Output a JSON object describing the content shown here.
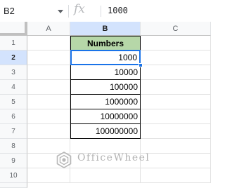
{
  "formula_bar": {
    "name_box": "B2",
    "fx_symbol": "fx",
    "formula_value": "1000"
  },
  "columns": [
    {
      "label": "A"
    },
    {
      "label": "B"
    },
    {
      "label": "C"
    }
  ],
  "rows": [
    "1",
    "2",
    "3",
    "4",
    "5",
    "6",
    "7",
    "8",
    "9",
    "10"
  ],
  "sheet": {
    "b_header": "Numbers",
    "b_values": [
      "1000",
      "10000",
      "100000",
      "1000000",
      "10000000",
      "100000000"
    ],
    "selected_cell": "B2"
  },
  "watermark": {
    "text": "OfficeWheel"
  },
  "colors": {
    "header_fill": "#b6d7a8",
    "selection": "#1a73e8",
    "active_header": "#d3e3fd"
  }
}
